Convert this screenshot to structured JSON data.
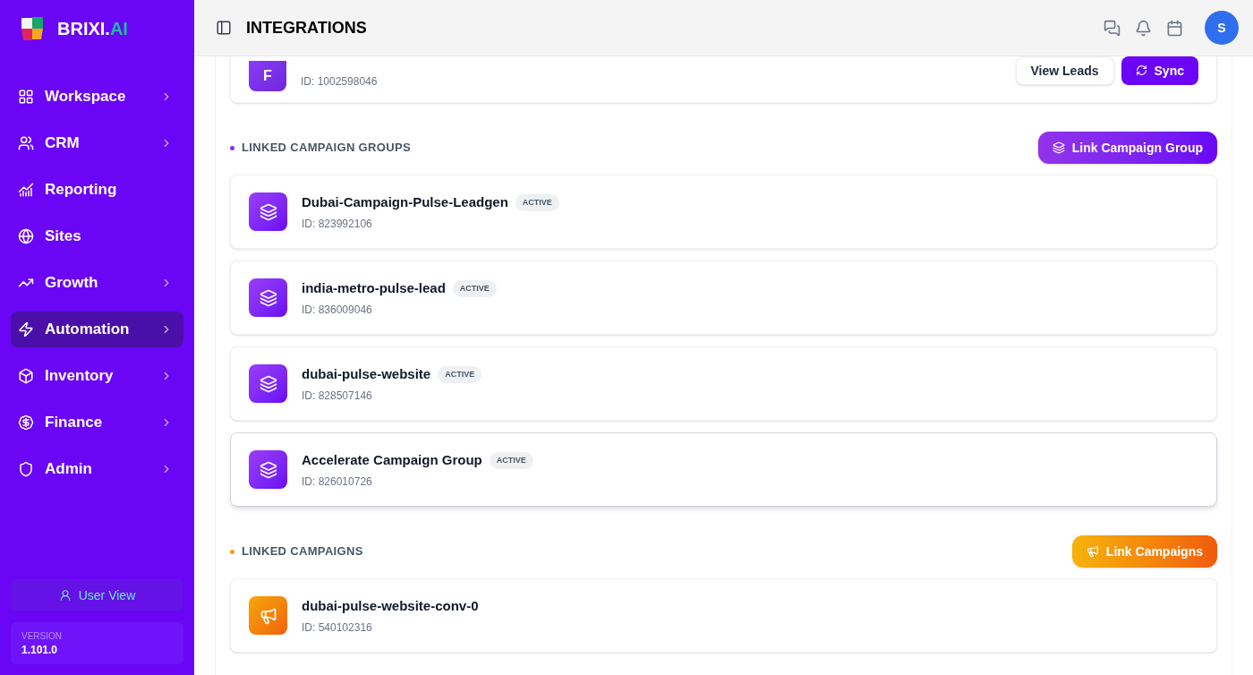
{
  "brand": {
    "name": "BRIXI.",
    "suffix": "AI"
  },
  "sidebar": {
    "items": [
      {
        "label": "Workspace",
        "chevron": true,
        "selected": false
      },
      {
        "label": "CRM",
        "chevron": true,
        "selected": false
      },
      {
        "label": "Reporting",
        "chevron": false,
        "selected": false
      },
      {
        "label": "Sites",
        "chevron": false,
        "selected": false
      },
      {
        "label": "Growth",
        "chevron": true,
        "selected": false
      },
      {
        "label": "Automation",
        "chevron": true,
        "selected": true
      },
      {
        "label": "Inventory",
        "chevron": true,
        "selected": false
      },
      {
        "label": "Finance",
        "chevron": true,
        "selected": false
      },
      {
        "label": "Admin",
        "chevron": true,
        "selected": false
      }
    ],
    "user_view": "User View",
    "version_label": "VERSION",
    "version": "1.101.0"
  },
  "header": {
    "title": "INTEGRATIONS",
    "avatar": "S"
  },
  "form_card": {
    "letter": "F",
    "id": "ID: 1002598046",
    "buttons": [
      {
        "label": "View Leads",
        "kind": "secondary"
      },
      {
        "label": "Sync",
        "kind": "primary"
      }
    ]
  },
  "sections": [
    {
      "title": "LINKED CAMPAIGN GROUPS",
      "kind": "group",
      "action": "Link Campaign Group",
      "items": [
        {
          "name": "Dubai-Campaign-Pulse-Leadgen",
          "badge": "ACTIVE",
          "id": "ID: 823992106",
          "selected": false
        },
        {
          "name": "india-metro-pulse-lead",
          "badge": "ACTIVE",
          "id": "ID: 836009046",
          "selected": false
        },
        {
          "name": "dubai-pulse-website",
          "badge": "ACTIVE",
          "id": "ID: 828507146",
          "selected": false
        },
        {
          "name": "Accelerate Campaign Group",
          "badge": "ACTIVE",
          "id": "ID: 826010726",
          "selected": true
        }
      ]
    },
    {
      "title": "LINKED CAMPAIGNS",
      "kind": "campaign",
      "action": "Link Campaigns",
      "items": [
        {
          "name": "dubai-pulse-website-conv-0",
          "id": "ID: 540102316",
          "selected": false
        }
      ]
    }
  ]
}
